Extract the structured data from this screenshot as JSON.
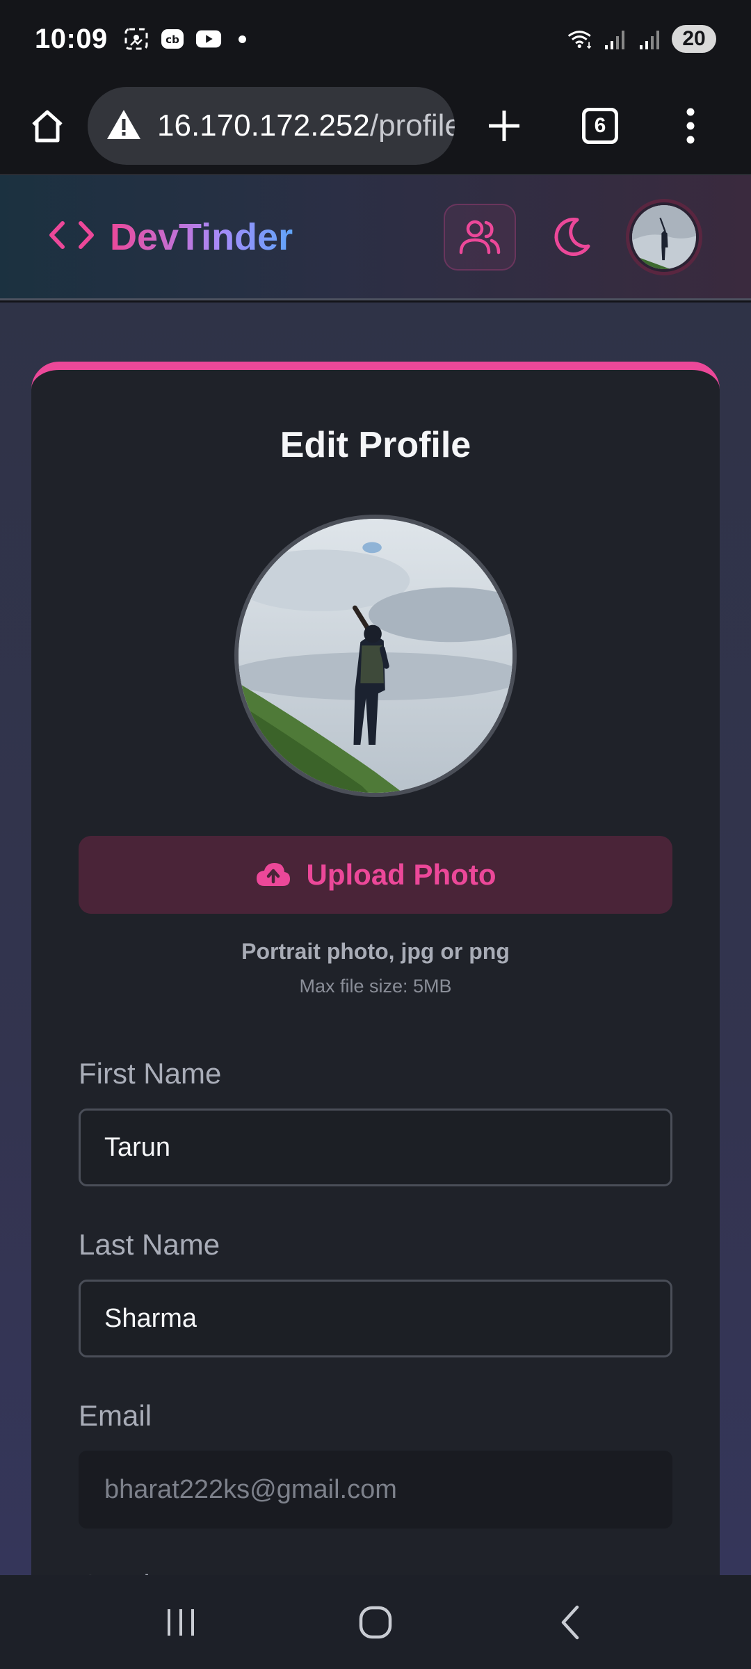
{
  "status_bar": {
    "time": "10:09",
    "battery": "20",
    "icons": [
      "screenshot-icon",
      "cb-app-icon",
      "youtube-icon",
      "notification-dot",
      "wifi-icon",
      "signal-icon",
      "signal-icon-2"
    ]
  },
  "browser": {
    "url_host": "16.170.172.252",
    "url_path": "/profile",
    "tab_count": "6",
    "security_icon": "warning-icon"
  },
  "navbar": {
    "brand_code": "< >",
    "brand_name": "DevTinder",
    "accent": "#ec4899"
  },
  "profile_form": {
    "title": "Edit Profile",
    "upload_label": "Upload Photo",
    "hint_main": "Portrait photo, jpg or png",
    "hint_sub": "Max file size: 5MB",
    "first_name": {
      "label": "First Name",
      "value": "Tarun"
    },
    "last_name": {
      "label": "Last Name",
      "value": "Sharma"
    },
    "email": {
      "label": "Email",
      "value": "bharat222ks@gmail.com"
    },
    "gender": {
      "label": "Gender"
    }
  },
  "colors": {
    "accent": "#ec4899",
    "card_bg": "#1f2229",
    "page_bg": "#2f3347"
  }
}
